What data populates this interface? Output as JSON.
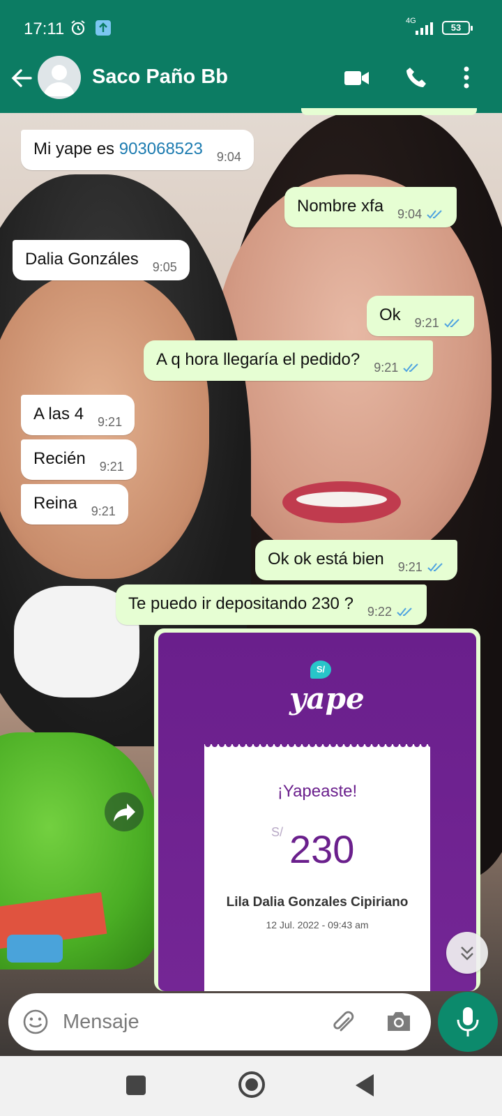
{
  "status_bar": {
    "time": "17:11",
    "network": "4G",
    "battery": "53"
  },
  "header": {
    "contact_name": "Saco Paño Bb"
  },
  "messages": [
    {
      "dir": "in",
      "text_prefix": "Mi yape es ",
      "link": "903068523",
      "time": "9:04"
    },
    {
      "dir": "out",
      "text": "Nombre xfa",
      "time": "9:04"
    },
    {
      "dir": "in",
      "text": "Dalia Gonzáles",
      "time": "9:05"
    },
    {
      "dir": "out",
      "text": "Ok",
      "time": "9:21"
    },
    {
      "dir": "out",
      "text": "A q hora llegaría el pedido?",
      "time": "9:21"
    },
    {
      "dir": "in",
      "text": "A las 4",
      "time": "9:21"
    },
    {
      "dir": "in",
      "text": "Recién",
      "time": "9:21"
    },
    {
      "dir": "in",
      "text": "Reina",
      "time": "9:21"
    },
    {
      "dir": "out",
      "text": "Ok ok está bien",
      "time": "9:21"
    },
    {
      "dir": "out",
      "text": "Te puedo ir depositando 230 ?",
      "time": "9:22"
    }
  ],
  "receipt": {
    "brand": "yape",
    "coin_symbol": "S/",
    "title": "¡Yapeaste!",
    "currency": "S/",
    "amount": "230",
    "payee": "Lila Dalia Gonzales Cipiriano",
    "date": "12 Jul. 2022 - 09:43 am"
  },
  "input": {
    "placeholder": "Mensaje"
  },
  "colors": {
    "header": "#0c7c63",
    "outgoing_bubble": "#e6fed3",
    "incoming_bubble": "#ffffff",
    "read_ticks": "#4fa3e0",
    "yape_purple": "#6a1f8c"
  }
}
